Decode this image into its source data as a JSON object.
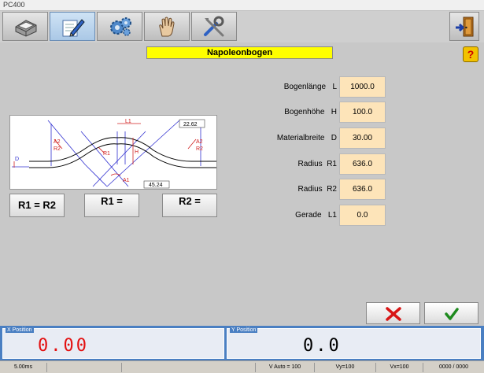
{
  "window": {
    "title": "PC400"
  },
  "toolbar": {
    "items": [
      {
        "icon": "press-machine-icon"
      },
      {
        "icon": "pencil-edit-icon"
      },
      {
        "icon": "gears-icon"
      },
      {
        "icon": "hand-icon"
      },
      {
        "icon": "tools-icon"
      }
    ],
    "exit_icon": "exit-door-icon"
  },
  "page": {
    "title": "Napoleonbogen",
    "help_label": "?"
  },
  "diagram": {
    "labels": {
      "l1": "L1",
      "h": "H",
      "a1": "A1",
      "a2_left": "A2",
      "a2_right": "A2",
      "r1": "R1",
      "r2_left": "R2",
      "r2_right": "R2",
      "d": "D",
      "dim_top": "22.62",
      "dim_bottom": "45.24"
    }
  },
  "radius_buttons": {
    "equal": "R1 = R2",
    "r1": "R1 =",
    "r2": "R2 ="
  },
  "params": [
    {
      "label": "Bogenlänge",
      "symbol": "L",
      "value": "1000.0"
    },
    {
      "label": "Bogenhöhe",
      "symbol": "H",
      "value": "100.0"
    },
    {
      "label": "Materialbreite",
      "symbol": "D",
      "value": "30.00"
    },
    {
      "label": "Radius",
      "symbol": "R1",
      "value": "636.0"
    },
    {
      "label": "Radius",
      "symbol": "R2",
      "value": "636.0"
    },
    {
      "label": "Gerade",
      "symbol": "L1",
      "value": "0.0"
    }
  ],
  "actions": {
    "cancel_icon": "cancel-x-icon",
    "ok_icon": "ok-check-icon",
    "cancel_color": "#d81616",
    "ok_color": "#1e8a1e"
  },
  "position": {
    "x_caption": "X Position",
    "x_value": "0.00",
    "y_caption": "Y Position",
    "y_value": "0.0"
  },
  "status": {
    "time": "5.00ms",
    "v_auto": "V Auto = 100",
    "vy": "Vy=100",
    "vx": "Vx=100",
    "counter": "0000 / 0000"
  }
}
